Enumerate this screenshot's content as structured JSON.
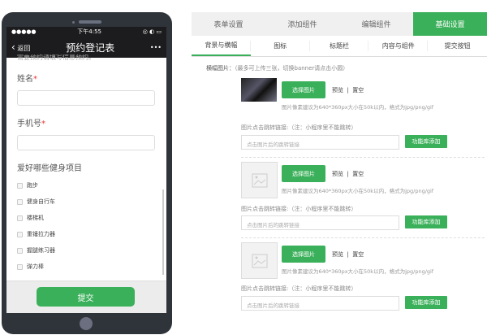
{
  "phone": {
    "status": {
      "signal": "●●●●●",
      "time": "下午4:55",
      "icons": "◎ ◐ ▭"
    },
    "nav": {
      "back": "返回",
      "title": "预约登记表",
      "more": "•••"
    },
    "cut_text": "需要预约请填写信息预约。",
    "fields": [
      {
        "label": "姓名",
        "required": "*"
      },
      {
        "label": "手机号",
        "required": "*"
      }
    ],
    "checkbox_group": {
      "label": "爱好哪些健身项目",
      "options": [
        "跑步",
        "健身自行车",
        "楼梯机",
        "重锤拉力器",
        "握腿练习器",
        "弹力棒"
      ]
    },
    "submit": "提交"
  },
  "tabs": [
    {
      "label": "表单设置"
    },
    {
      "label": "添加组件"
    },
    {
      "label": "编辑组件"
    },
    {
      "label": "基础设置"
    }
  ],
  "subtabs": [
    {
      "label": "背景与横幅"
    },
    {
      "label": "图标"
    },
    {
      "label": "标题栏"
    },
    {
      "label": "内容与组件"
    },
    {
      "label": "提交按钮"
    }
  ],
  "banner": {
    "label": "横幅图片：",
    "note": "（最多可上传三张，切换banner请点击小圆）",
    "select": "选择图片",
    "preview": "预览",
    "sep": "|",
    "clear": "置空",
    "hint": "图片像素建议为640*360px大小在50k以内，格式为jpg/png/gif",
    "link_label": "图片点击跳转链接:（注：小程序里不能跳转）",
    "link_placeholder": "点击图片后的跳转链接",
    "add": "功能库添加"
  }
}
